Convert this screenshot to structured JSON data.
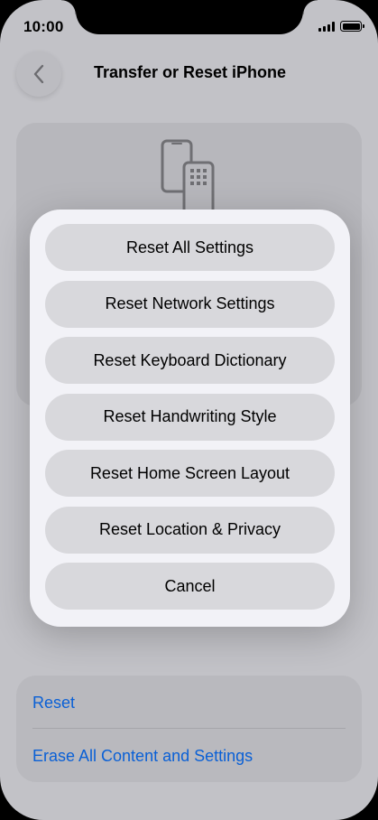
{
  "status_bar": {
    "time": "10:00"
  },
  "nav": {
    "title": "Transfer or Reset iPhone",
    "back_icon": "chevron-left-icon"
  },
  "illustration": {
    "icon": "devices-transfer-icon"
  },
  "action_sheet": {
    "buttons": [
      {
        "label": "Reset All Settings"
      },
      {
        "label": "Reset Network Settings"
      },
      {
        "label": "Reset Keyboard Dictionary"
      },
      {
        "label": "Reset Handwriting Style"
      },
      {
        "label": "Reset Home Screen Layout"
      },
      {
        "label": "Reset Location & Privacy"
      },
      {
        "label": "Cancel"
      }
    ]
  },
  "list": {
    "reset_label": "Reset",
    "erase_label": "Erase All Content and Settings"
  },
  "colors": {
    "link_blue": "#0a60d6",
    "sheet_background": "#f2f2f7",
    "sheet_button": "#d8d8dc",
    "dimmed_background": "#c2c2c7"
  }
}
